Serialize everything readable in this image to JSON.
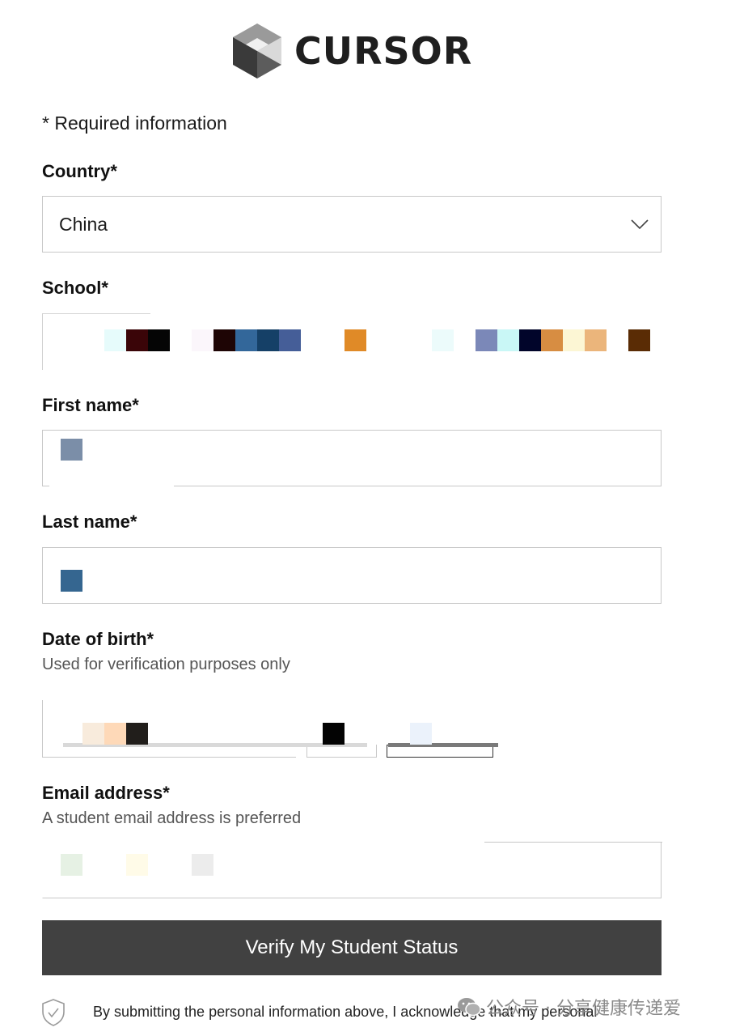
{
  "brand": {
    "name": "CURSOR",
    "icon": "cube-logo-icon"
  },
  "form": {
    "required_note": "* Required information",
    "country": {
      "label": "Country*",
      "value": "China",
      "icon": "chevron-down-icon"
    },
    "school": {
      "label": "School*"
    },
    "first_name": {
      "label": "First name*"
    },
    "last_name": {
      "label": "Last name*"
    },
    "dob": {
      "label": "Date of birth*",
      "hint": "Used for verification purposes only"
    },
    "email": {
      "label": "Email address*",
      "hint": "A student email address is preferred"
    },
    "submit_label": "Verify My Student Status",
    "consent_text": "By submitting the personal information above, I acknowledge that my personal",
    "consent_icon": "shield-check-icon"
  },
  "watermark": {
    "text": "公众号 · 分享健康传递爱",
    "icon": "wechat-icon"
  }
}
